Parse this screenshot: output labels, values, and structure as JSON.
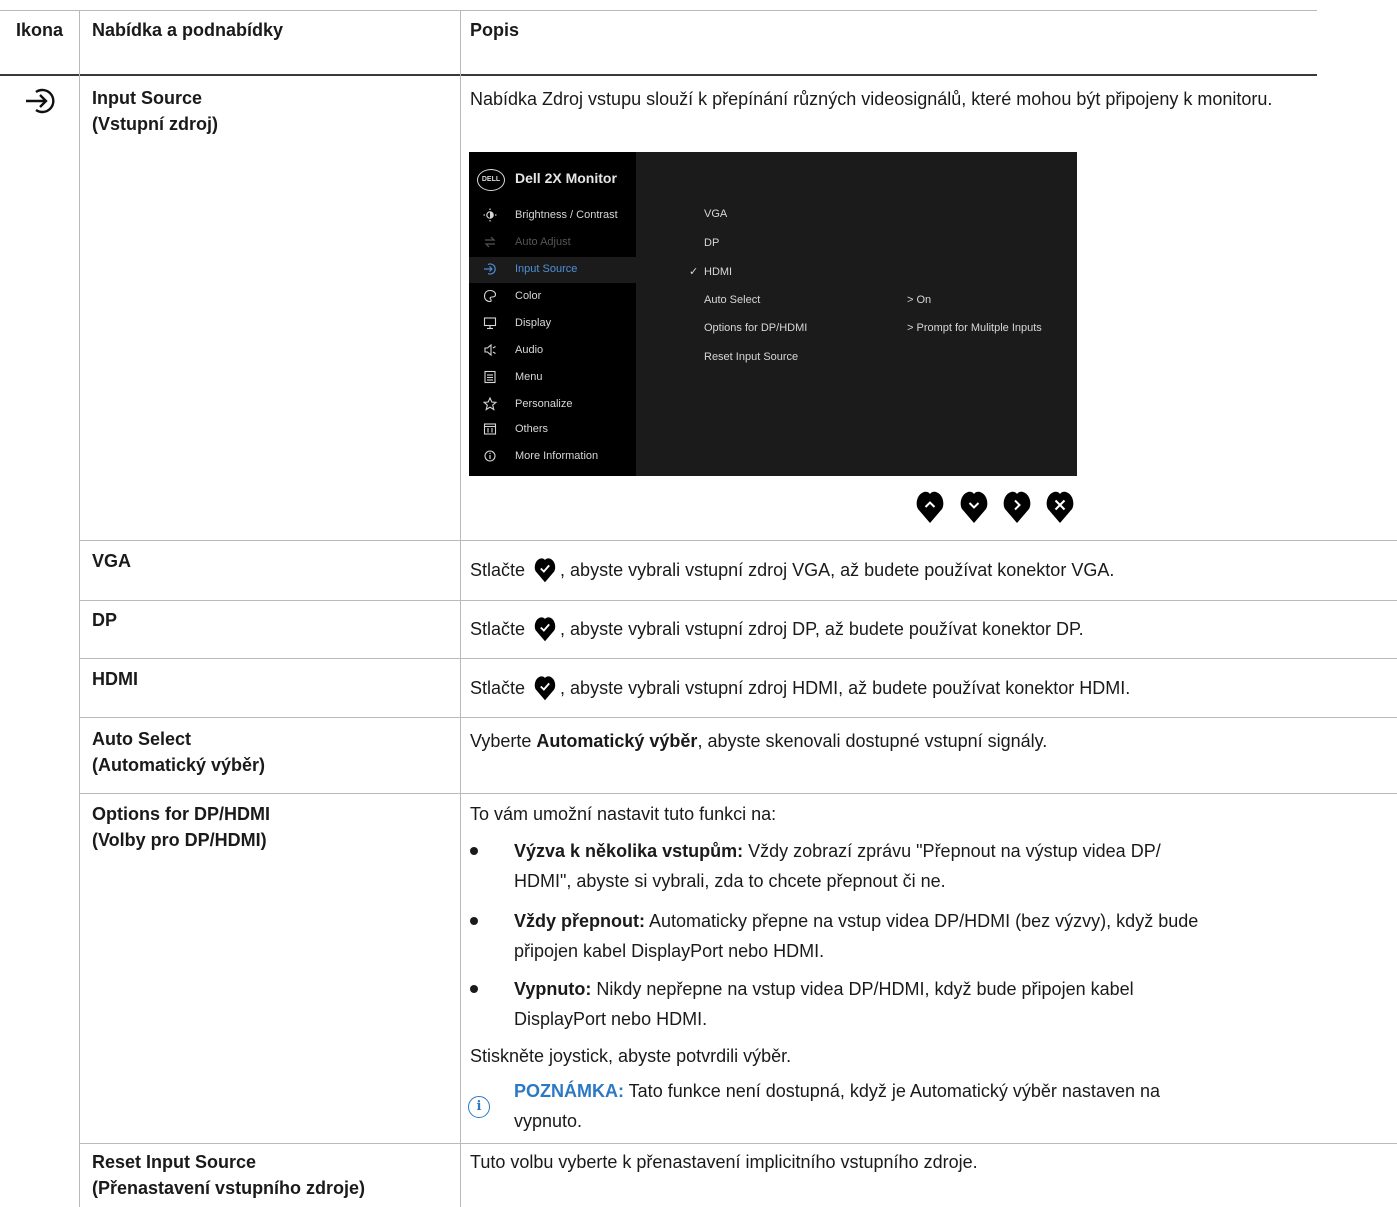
{
  "header": {
    "col_icon": "Ikona",
    "col_menu": "Nabídka a podnabídky",
    "col_desc": "Popis"
  },
  "rows": {
    "input_source": {
      "title_1": "Input Source",
      "title_2": "(Vstupní zdroj)",
      "desc": "Nabídka Zdroj vstupu slouží k přepínání různých videosignálů, které mohou být připojeny k monitoru.",
      "icon": "input-source-icon"
    },
    "vga": {
      "title": "VGA",
      "desc_pre": "Stlačte",
      "desc_post": ", abyste vybrali vstupní zdroj VGA, až budete používat konektor VGA."
    },
    "dp": {
      "title": "DP",
      "desc_pre": "Stlačte",
      "desc_post": ", abyste vybrali vstupní zdroj DP, až budete používat konektor DP."
    },
    "hdmi": {
      "title": "HDMI",
      "desc_pre": "Stlačte",
      "desc_post": ", abyste vybrali vstupní zdroj HDMI, až budete používat konektor HDMI."
    },
    "auto_select": {
      "title_1": "Auto Select",
      "title_2": "(Automatický výběr)",
      "desc_pre": "Vyberte ",
      "desc_bold": "Automatický výběr",
      "desc_post": ", abyste skenovali dostupné vstupní signály."
    },
    "options": {
      "title_1": "Options for DP/HDMI",
      "title_2": "(Volby pro DP/HDMI)",
      "intro": "To vám umožní nastavit tuto funkci na:",
      "bullets": [
        {
          "bold": "Výzva k několika vstupům:",
          "line1": " Vždy zobrazí zprávu \"Přepnout na výstup videa DP/",
          "line2": "HDMI\", abyste si vybrali, zda to chcete přepnout či ne."
        },
        {
          "bold": "Vždy přepnout:",
          "line1": " Automaticky přepne na vstup videa DP/HDMI (bez výzvy), když bude",
          "line2": "připojen kabel DisplayPort nebo HDMI."
        },
        {
          "bold": "Vypnuto:",
          "line1": " Nikdy nepřepne na vstup videa DP/HDMI, když bude připojen kabel",
          "line2": "DisplayPort nebo HDMI."
        }
      ],
      "confirm": "Stiskněte joystick, abyste potvrdili výběr.",
      "note_label": "POZNÁMKA:",
      "note_line1": " Tato funkce není dostupná, když je Automatický výběr nastaven na",
      "note_line2": "vypnuto."
    },
    "reset": {
      "title_1": "Reset Input Source",
      "title_2": "(Přenastavení vstupního zdroje)",
      "desc": "Tuto volbu vyberte k přenastavení implicitního vstupního zdroje."
    }
  },
  "osd": {
    "logo": "DELL",
    "title": "Dell 2X Monitor",
    "menu": [
      {
        "label": "Brightness / Contrast",
        "icon": "brightness-icon",
        "state": "normal"
      },
      {
        "label": "Auto Adjust",
        "icon": "auto-adjust-icon",
        "state": "disabled"
      },
      {
        "label": "Input Source",
        "icon": "input-source-icon",
        "state": "selected"
      },
      {
        "label": "Color",
        "icon": "color-icon",
        "state": "normal"
      },
      {
        "label": "Display",
        "icon": "display-icon",
        "state": "normal"
      },
      {
        "label": "Audio",
        "icon": "audio-icon",
        "state": "normal"
      },
      {
        "label": "Menu",
        "icon": "menu-icon",
        "state": "normal"
      },
      {
        "label": "Personalize",
        "icon": "star-icon",
        "state": "normal"
      },
      {
        "label": "Others",
        "icon": "others-icon",
        "state": "normal"
      },
      {
        "label": "More Information",
        "icon": "info-icon",
        "state": "normal"
      }
    ],
    "submenu": [
      {
        "label": "VGA",
        "value": ""
      },
      {
        "label": "DP",
        "value": ""
      },
      {
        "label": "HDMI",
        "value": "",
        "checked": true
      },
      {
        "label": "Auto Select",
        "value": "> On"
      },
      {
        "label": "Options for DP/HDMI",
        "value": "> Prompt for Mulitple Inputs"
      },
      {
        "label": "Reset Input Source",
        "value": ""
      }
    ],
    "check_mark": "✓",
    "nav_buttons": [
      "up-button",
      "down-button",
      "right-button",
      "exit-button"
    ]
  }
}
